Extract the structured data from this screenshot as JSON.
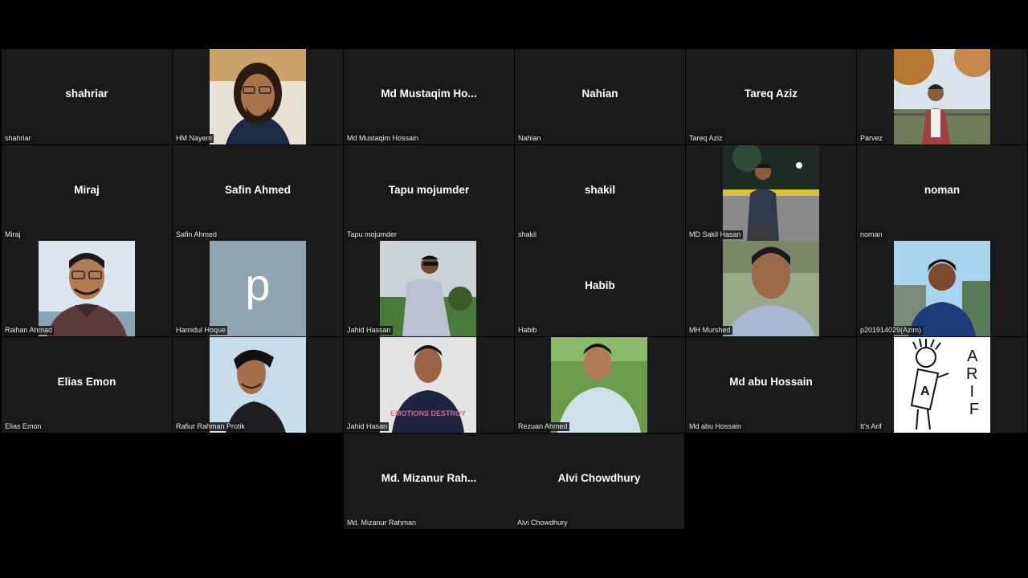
{
  "participants": [
    {
      "display": "shahriar",
      "label": "shahriar"
    },
    {
      "display": "",
      "label": "HM Nayem"
    },
    {
      "display": "Md  Mustaqim  Ho...",
      "label": "Md Mustaqim Hossain"
    },
    {
      "display": "Nahian",
      "label": "Nahian"
    },
    {
      "display": "Tareq Aziz",
      "label": "Tareq Aziz"
    },
    {
      "display": "",
      "label": "Parvez"
    },
    {
      "display": "Miraj",
      "label": "Miraj"
    },
    {
      "display": "Safin Ahmed",
      "label": "Safin Ahmed"
    },
    {
      "display": "Tapu mojumder",
      "label": "Tapu mojumder"
    },
    {
      "display": "shakil",
      "label": "shakil"
    },
    {
      "display": "",
      "label": "MD Sakil Hasan"
    },
    {
      "display": "noman",
      "label": "noman"
    },
    {
      "display": "",
      "label": "Raihan Ahmad"
    },
    {
      "display": "p",
      "label": "Hamidul Hoque"
    },
    {
      "display": "",
      "label": "Jahid Hassan"
    },
    {
      "display": "Habib",
      "label": "Habib"
    },
    {
      "display": "",
      "label": "MH Murshed"
    },
    {
      "display": "",
      "label": "p201914029(Azim)"
    },
    {
      "display": "Elias Emon",
      "label": "Elias Emon"
    },
    {
      "display": "",
      "label": "Rafiur Rahman Protik"
    },
    {
      "display": "",
      "label": "Jahid Hasan"
    },
    {
      "display": "",
      "label": "Rezuan Ahmed"
    },
    {
      "display": "Md abu Hossain",
      "label": "Md abu Hossain"
    },
    {
      "display": "",
      "label": "It's Arif"
    },
    {
      "display": "Md.  Mizanur  Rah...",
      "label": "Md. Mizanur Rahman"
    },
    {
      "display": "Alvi Chowdhury",
      "label": "Alvi Chowdhury"
    }
  ],
  "avatar_letter": "p",
  "arif_drawing_text": "A\nR\nI\nF",
  "arif_shirt_letter": "A",
  "shirt_text": "EMOTIONS DESTROY",
  "colors": {
    "background": "#000000",
    "tile": "#1a1a1a",
    "avatar_bg": "#8fa3b0"
  }
}
